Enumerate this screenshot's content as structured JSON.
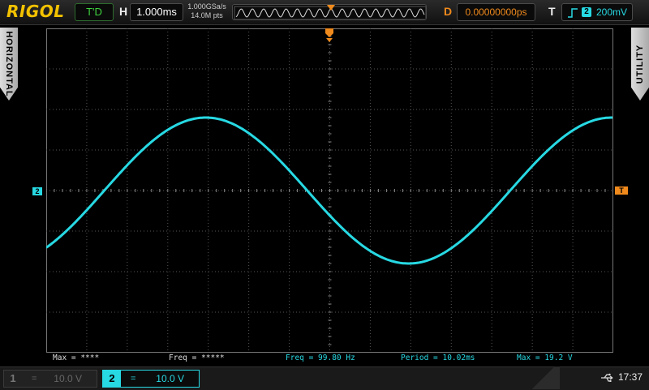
{
  "brand": "RIGOL",
  "header": {
    "run_state": "T'D",
    "h_label": "H",
    "timebase": "1.000ms",
    "sample_rate": "1.000GSa/s",
    "mem_depth": "14.0M pts",
    "d_label": "D",
    "delay": "0.00000000ps",
    "t_label": "T",
    "trigger_channel": "2",
    "trigger_level": "200mV"
  },
  "side_tabs": {
    "left": "HORIZONTAL",
    "right": "UTILITY"
  },
  "channels": [
    {
      "num": "1",
      "coupling": "=",
      "scale": "10.0 V",
      "active": false,
      "color": "#666666"
    },
    {
      "num": "2",
      "coupling": "=",
      "scale": "10.0 V",
      "active": true,
      "color": "#27d9e3"
    }
  ],
  "waveform": {
    "channel": "2",
    "frequency_hz": 99.8,
    "amplitude_divs": 1.8,
    "phase_deg": -20,
    "color": "#27d9e3"
  },
  "grid": {
    "hdivs": 14,
    "vdivs": 8
  },
  "markers": {
    "ch2": "2",
    "trigger": "T"
  },
  "measurements": [
    {
      "text": "Max = ****",
      "color": "white"
    },
    {
      "text": "Freq = *****",
      "color": "white"
    },
    {
      "text": "Freq = 99.80 Hz",
      "color": "cyan"
    },
    {
      "text": "Period = 10.02ms",
      "color": "cyan"
    },
    {
      "text": "Max = 19.2 V",
      "color": "cyan"
    }
  ],
  "status": {
    "clock": "17:37",
    "usb": "usb-icon"
  },
  "colors": {
    "accent": "#27d9e3",
    "trigger": "#f08a1c",
    "brand": "#f2c200",
    "run": "#3fd23f"
  }
}
